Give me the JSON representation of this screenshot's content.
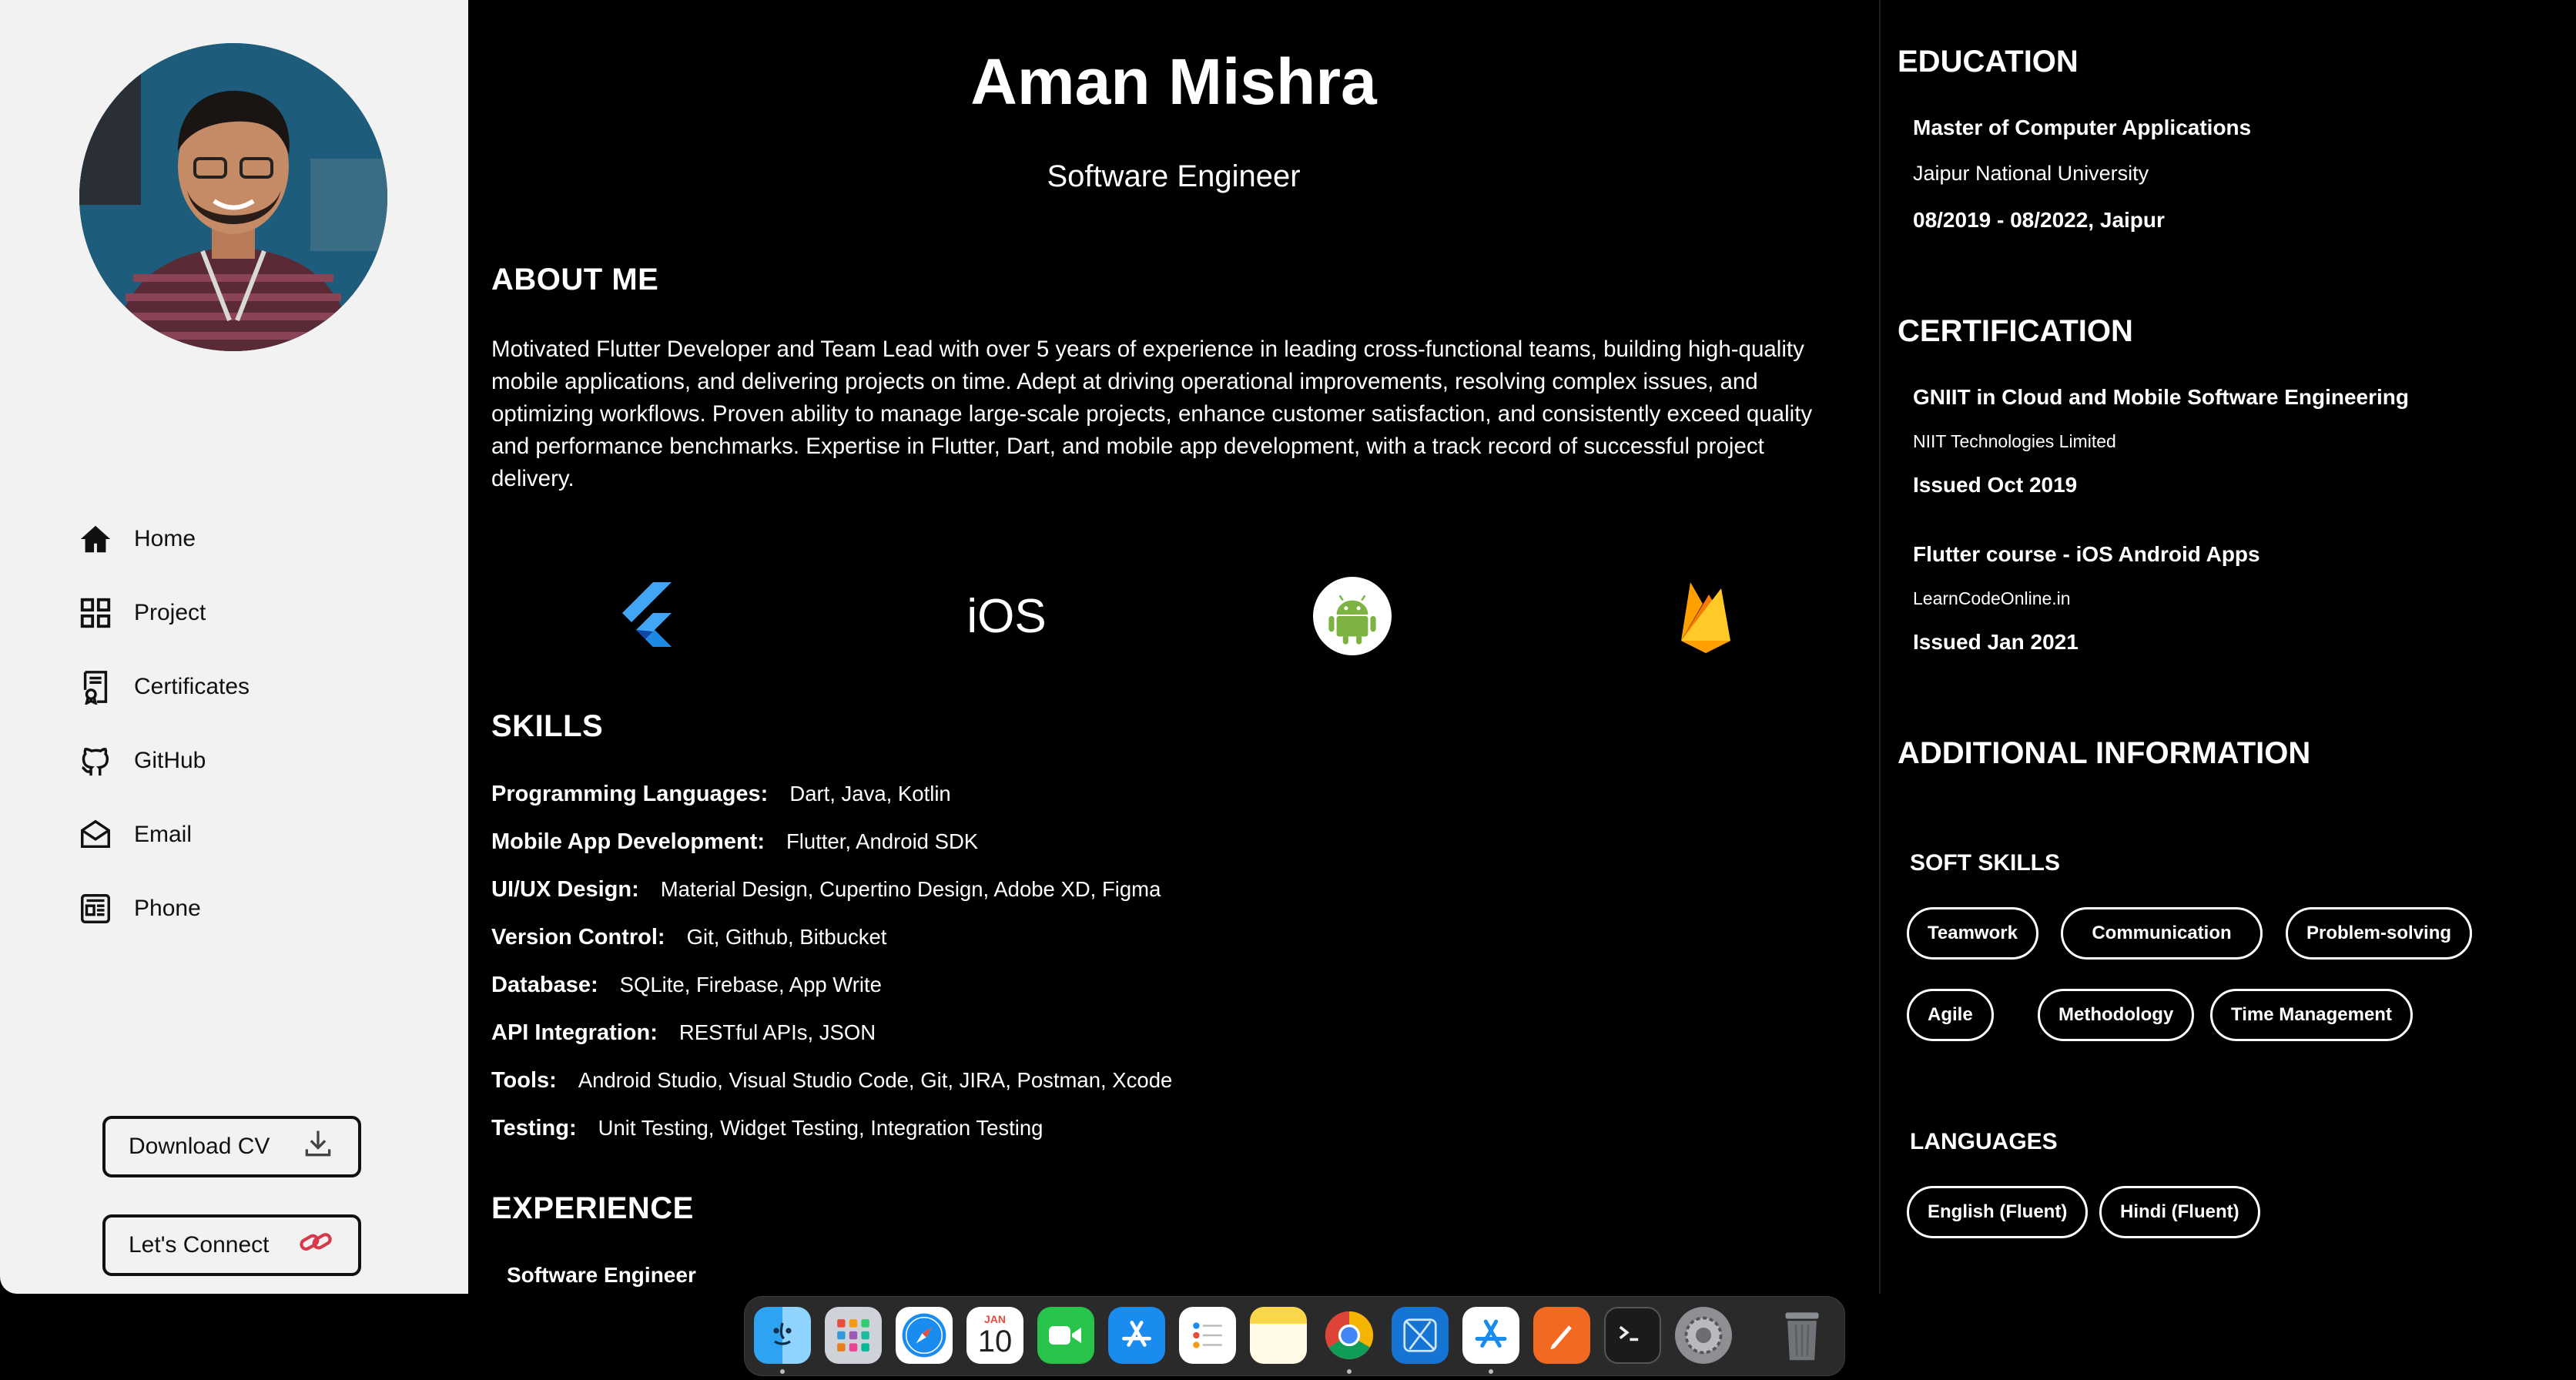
{
  "sidebar": {
    "nav": [
      {
        "label": "Home",
        "icon": "home-icon"
      },
      {
        "label": "Project",
        "icon": "grid-icon"
      },
      {
        "label": "Certificates",
        "icon": "certificate-icon"
      },
      {
        "label": "GitHub",
        "icon": "github-icon"
      },
      {
        "label": "Email",
        "icon": "email-icon"
      },
      {
        "label": "Phone",
        "icon": "phone-card-icon"
      }
    ],
    "download_cv": "Download CV",
    "lets_connect": "Let's Connect"
  },
  "header": {
    "name": "Aman Mishra",
    "role": "Software Engineer"
  },
  "about": {
    "title": "ABOUT ME",
    "text": "Motivated Flutter Developer and Team Lead with over 5 years of experience in leading cross-functional teams, building high-quality mobile applications, and delivering projects on time. Adept at driving operational improvements, resolving complex issues, and optimizing workflows. Proven ability to manage large-scale projects, enhance customer satisfaction, and consistently exceed quality and performance benchmarks. Expertise in Flutter, Dart, and mobile app development, with a track record of successful project delivery."
  },
  "tech_icons": [
    "flutter-icon",
    "ios-icon",
    "android-icon",
    "firebase-icon"
  ],
  "tech_ios_label": "iOS",
  "skills": {
    "title": "SKILLS",
    "rows": [
      {
        "key": "Programming Languages:",
        "value": "Dart, Java, Kotlin"
      },
      {
        "key": "Mobile App Development:",
        "value": "Flutter, Android SDK"
      },
      {
        "key": "UI/UX Design:",
        "value": "Material Design, Cupertino Design, Adobe XD, Figma"
      },
      {
        "key": "Version Control:",
        "value": "Git, Github, Bitbucket"
      },
      {
        "key": "Database:",
        "value": "SQLite, Firebase, App Write"
      },
      {
        "key": "API Integration:",
        "value": "RESTful APIs, JSON"
      },
      {
        "key": "Tools:",
        "value": "Android Studio, Visual Studio Code, Git, JIRA, Postman, Xcode"
      },
      {
        "key": "Testing:",
        "value": "Unit Testing, Widget Testing, Integration Testing"
      }
    ]
  },
  "experience": {
    "title": "EXPERIENCE",
    "first_role": "Software Engineer"
  },
  "education": {
    "title": "EDUCATION",
    "degree": "Master of Computer Applications",
    "school": "Jaipur National University",
    "period": "08/2019 - 08/2022, Jaipur"
  },
  "certification": {
    "title": "CERTIFICATION",
    "items": [
      {
        "name": "GNIIT in Cloud and Mobile Software Engineering",
        "issuer": "NIIT Technologies Limited",
        "issued": "Issued Oct 2019"
      },
      {
        "name": "Flutter course - iOS Android Apps",
        "issuer": "LearnCodeOnline.in",
        "issued": "Issued Jan 2021"
      }
    ]
  },
  "additional": {
    "title": "ADDITIONAL INFORMATION",
    "soft_skills_title": "SOFT SKILLS",
    "soft_skills": [
      "Teamwork",
      "Communication",
      "Problem-solving",
      "Agile",
      "Methodology",
      "Time Management"
    ],
    "languages_title": "LANGUAGES",
    "languages": [
      "English (Fluent)",
      "Hindi (Fluent)"
    ]
  },
  "dock": {
    "apps": [
      "finder-icon",
      "launchpad-icon",
      "safari-icon",
      "calendar-icon",
      "facetime-icon",
      "app-store-icon",
      "reminders-icon",
      "notes-icon",
      "chrome-icon",
      "xcode-icon",
      "instruments-icon",
      "pages-icon",
      "terminal-icon",
      "system-settings-icon",
      "trash-icon"
    ],
    "calendar_month": "JAN",
    "calendar_day": "10"
  },
  "colors": {
    "sidebar_bg": "#f2f2f2",
    "main_bg": "#000000",
    "accent_link": "#d63a4a"
  }
}
